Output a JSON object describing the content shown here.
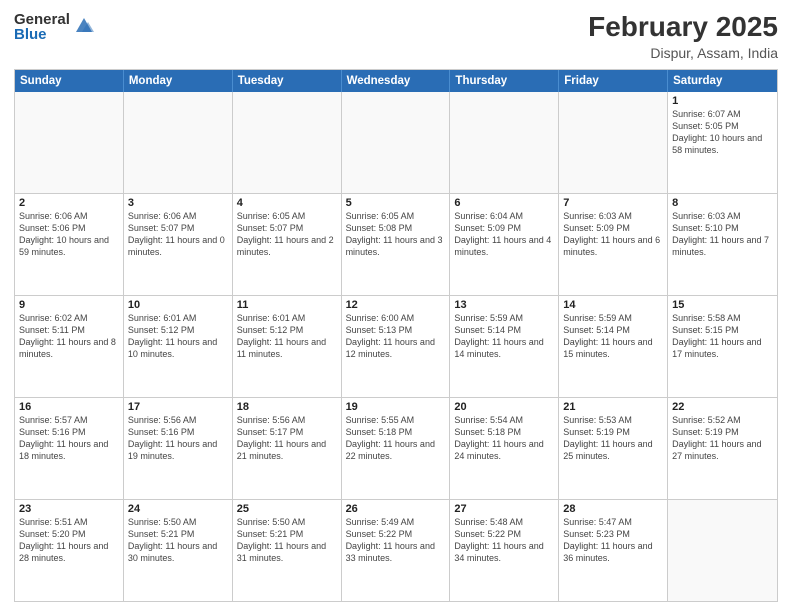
{
  "header": {
    "logo_general": "General",
    "logo_blue": "Blue",
    "title": "February 2025",
    "location": "Dispur, Assam, India"
  },
  "days_of_week": [
    "Sunday",
    "Monday",
    "Tuesday",
    "Wednesday",
    "Thursday",
    "Friday",
    "Saturday"
  ],
  "weeks": [
    [
      {
        "day": "",
        "info": ""
      },
      {
        "day": "",
        "info": ""
      },
      {
        "day": "",
        "info": ""
      },
      {
        "day": "",
        "info": ""
      },
      {
        "day": "",
        "info": ""
      },
      {
        "day": "",
        "info": ""
      },
      {
        "day": "1",
        "info": "Sunrise: 6:07 AM\nSunset: 5:05 PM\nDaylight: 10 hours\nand 58 minutes."
      }
    ],
    [
      {
        "day": "2",
        "info": "Sunrise: 6:06 AM\nSunset: 5:06 PM\nDaylight: 10 hours\nand 59 minutes."
      },
      {
        "day": "3",
        "info": "Sunrise: 6:06 AM\nSunset: 5:07 PM\nDaylight: 11 hours\nand 0 minutes."
      },
      {
        "day": "4",
        "info": "Sunrise: 6:05 AM\nSunset: 5:07 PM\nDaylight: 11 hours\nand 2 minutes."
      },
      {
        "day": "5",
        "info": "Sunrise: 6:05 AM\nSunset: 5:08 PM\nDaylight: 11 hours\nand 3 minutes."
      },
      {
        "day": "6",
        "info": "Sunrise: 6:04 AM\nSunset: 5:09 PM\nDaylight: 11 hours\nand 4 minutes."
      },
      {
        "day": "7",
        "info": "Sunrise: 6:03 AM\nSunset: 5:09 PM\nDaylight: 11 hours\nand 6 minutes."
      },
      {
        "day": "8",
        "info": "Sunrise: 6:03 AM\nSunset: 5:10 PM\nDaylight: 11 hours\nand 7 minutes."
      }
    ],
    [
      {
        "day": "9",
        "info": "Sunrise: 6:02 AM\nSunset: 5:11 PM\nDaylight: 11 hours\nand 8 minutes."
      },
      {
        "day": "10",
        "info": "Sunrise: 6:01 AM\nSunset: 5:12 PM\nDaylight: 11 hours\nand 10 minutes."
      },
      {
        "day": "11",
        "info": "Sunrise: 6:01 AM\nSunset: 5:12 PM\nDaylight: 11 hours\nand 11 minutes."
      },
      {
        "day": "12",
        "info": "Sunrise: 6:00 AM\nSunset: 5:13 PM\nDaylight: 11 hours\nand 12 minutes."
      },
      {
        "day": "13",
        "info": "Sunrise: 5:59 AM\nSunset: 5:14 PM\nDaylight: 11 hours\nand 14 minutes."
      },
      {
        "day": "14",
        "info": "Sunrise: 5:59 AM\nSunset: 5:14 PM\nDaylight: 11 hours\nand 15 minutes."
      },
      {
        "day": "15",
        "info": "Sunrise: 5:58 AM\nSunset: 5:15 PM\nDaylight: 11 hours\nand 17 minutes."
      }
    ],
    [
      {
        "day": "16",
        "info": "Sunrise: 5:57 AM\nSunset: 5:16 PM\nDaylight: 11 hours\nand 18 minutes."
      },
      {
        "day": "17",
        "info": "Sunrise: 5:56 AM\nSunset: 5:16 PM\nDaylight: 11 hours\nand 19 minutes."
      },
      {
        "day": "18",
        "info": "Sunrise: 5:56 AM\nSunset: 5:17 PM\nDaylight: 11 hours\nand 21 minutes."
      },
      {
        "day": "19",
        "info": "Sunrise: 5:55 AM\nSunset: 5:18 PM\nDaylight: 11 hours\nand 22 minutes."
      },
      {
        "day": "20",
        "info": "Sunrise: 5:54 AM\nSunset: 5:18 PM\nDaylight: 11 hours\nand 24 minutes."
      },
      {
        "day": "21",
        "info": "Sunrise: 5:53 AM\nSunset: 5:19 PM\nDaylight: 11 hours\nand 25 minutes."
      },
      {
        "day": "22",
        "info": "Sunrise: 5:52 AM\nSunset: 5:19 PM\nDaylight: 11 hours\nand 27 minutes."
      }
    ],
    [
      {
        "day": "23",
        "info": "Sunrise: 5:51 AM\nSunset: 5:20 PM\nDaylight: 11 hours\nand 28 minutes."
      },
      {
        "day": "24",
        "info": "Sunrise: 5:50 AM\nSunset: 5:21 PM\nDaylight: 11 hours\nand 30 minutes."
      },
      {
        "day": "25",
        "info": "Sunrise: 5:50 AM\nSunset: 5:21 PM\nDaylight: 11 hours\nand 31 minutes."
      },
      {
        "day": "26",
        "info": "Sunrise: 5:49 AM\nSunset: 5:22 PM\nDaylight: 11 hours\nand 33 minutes."
      },
      {
        "day": "27",
        "info": "Sunrise: 5:48 AM\nSunset: 5:22 PM\nDaylight: 11 hours\nand 34 minutes."
      },
      {
        "day": "28",
        "info": "Sunrise: 5:47 AM\nSunset: 5:23 PM\nDaylight: 11 hours\nand 36 minutes."
      },
      {
        "day": "",
        "info": ""
      }
    ]
  ]
}
